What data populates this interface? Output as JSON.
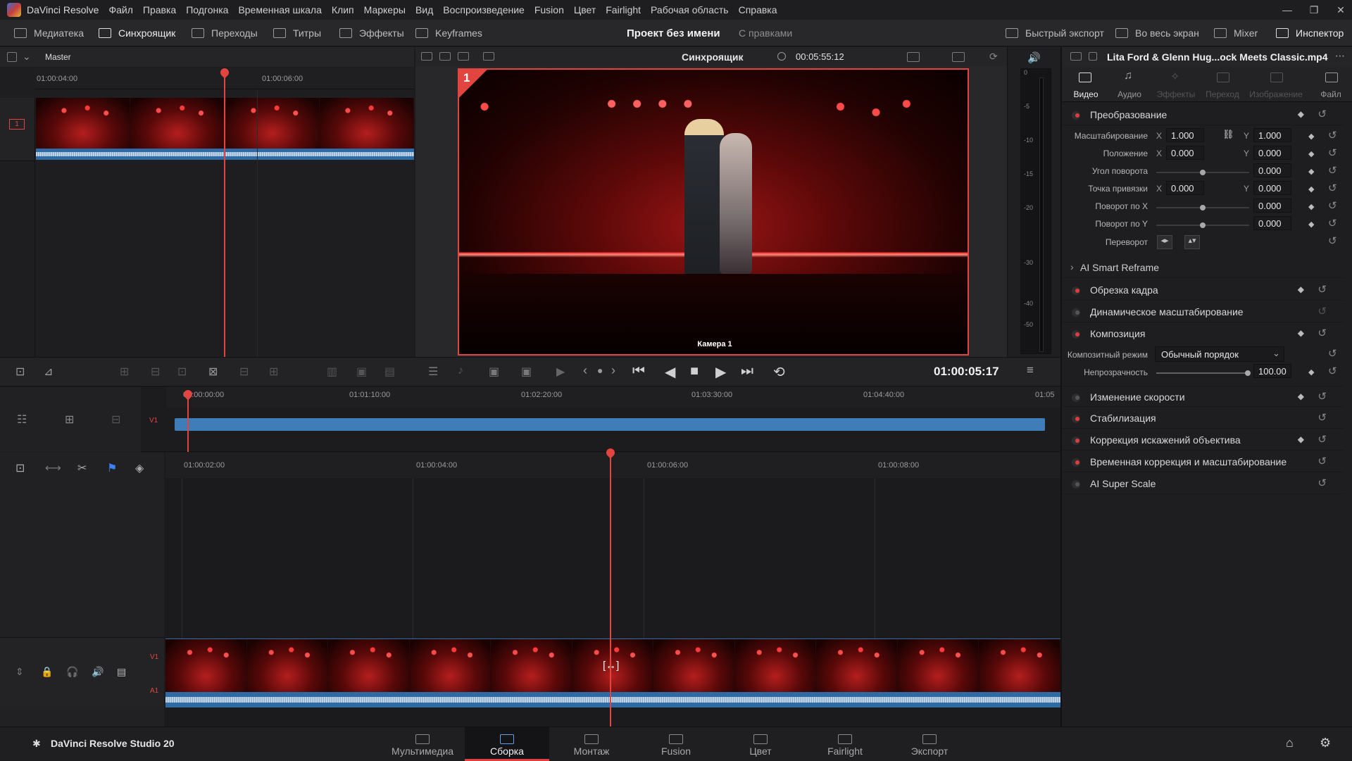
{
  "menubar": {
    "app": "DaVinci Resolve",
    "items": [
      "Файл",
      "Правка",
      "Подгонка",
      "Временная шкала",
      "Клип",
      "Маркеры",
      "Вид",
      "Воспроизведение",
      "Fusion",
      "Цвет",
      "Fairlight",
      "Рабочая область",
      "Справка"
    ],
    "win": [
      "—",
      "❐",
      "✕"
    ]
  },
  "toolbar": {
    "media": "Медиатека",
    "sync": "Синхроящик",
    "transitions": "Переходы",
    "titles": "Титры",
    "effects": "Эффекты",
    "keyframes": "Keyframes",
    "project": "Проект без имени",
    "edited": "С правками",
    "quick_export": "Быстрый экспорт",
    "fullscreen": "Во весь экран",
    "mixer": "Mixer",
    "inspector": "Инспектор"
  },
  "source": {
    "bin": "Master",
    "t1": "01:00:04:00",
    "t2": "01:00:06:00",
    "track": "1"
  },
  "viewer": {
    "title": "Синхроящик",
    "timecode": "00:05:55:12",
    "cam_label": "Камера 1",
    "angle": "1",
    "current_tc": "01:00:05:17"
  },
  "meter": {
    "scale": [
      "0",
      "-5",
      "-10",
      "-15",
      "-20",
      "-30",
      "-40",
      "-50"
    ]
  },
  "upper_tl": {
    "ticks": [
      "01:00:00:00",
      "01:01:10:00",
      "01:02:20:00",
      "01:03:30:00",
      "01:04:40:00",
      "01:05"
    ],
    "track": "V1"
  },
  "lower_tl": {
    "ticks": [
      "01:00:02:00",
      "01:00:04:00",
      "01:00:06:00",
      "01:00:08:00"
    ],
    "v1": "V1",
    "a1": "A1"
  },
  "inspector": {
    "clip": "Lita Ford & Glenn Hug...ock Meets Classic.mp4",
    "tabs": [
      "Видео",
      "Аудио",
      "Эффекты",
      "Переход",
      "Изображение",
      "Файл"
    ],
    "transform": "Преобразование",
    "scale_lbl": "Масштабирование",
    "scale_x": "1.000",
    "scale_y": "1.000",
    "pos_lbl": "Положение",
    "pos_x": "0.000",
    "pos_y": "0.000",
    "rot_lbl": "Угол поворота",
    "rot": "0.000",
    "anchor_lbl": "Точка привязки",
    "anchor_x": "0.000",
    "anchor_y": "0.000",
    "pitch_lbl": "Поворот по X",
    "pitch": "0.000",
    "yaw_lbl": "Поворот по Y",
    "yaw": "0.000",
    "flip_lbl": "Переворот",
    "x": "X",
    "y": "Y",
    "smart_reframe": "AI Smart Reframe",
    "crop": "Обрезка кадра",
    "dynzoom": "Динамическое масштабирование",
    "composite": "Композиция",
    "comp_mode_lbl": "Композитный режим",
    "comp_mode": "Обычный порядок",
    "opacity_lbl": "Непрозрачность",
    "opacity": "100.00",
    "speed": "Изменение скорости",
    "stab": "Стабилизация",
    "lens": "Коррекция искажений объектива",
    "retime": "Временная коррекция и масштабирование",
    "superscale": "AI Super Scale"
  },
  "pages": {
    "brand": "DaVinci Resolve Studio 20",
    "items": [
      "Мультимедиа",
      "Сборка",
      "Монтаж",
      "Fusion",
      "Цвет",
      "Fairlight",
      "Экспорт"
    ]
  }
}
